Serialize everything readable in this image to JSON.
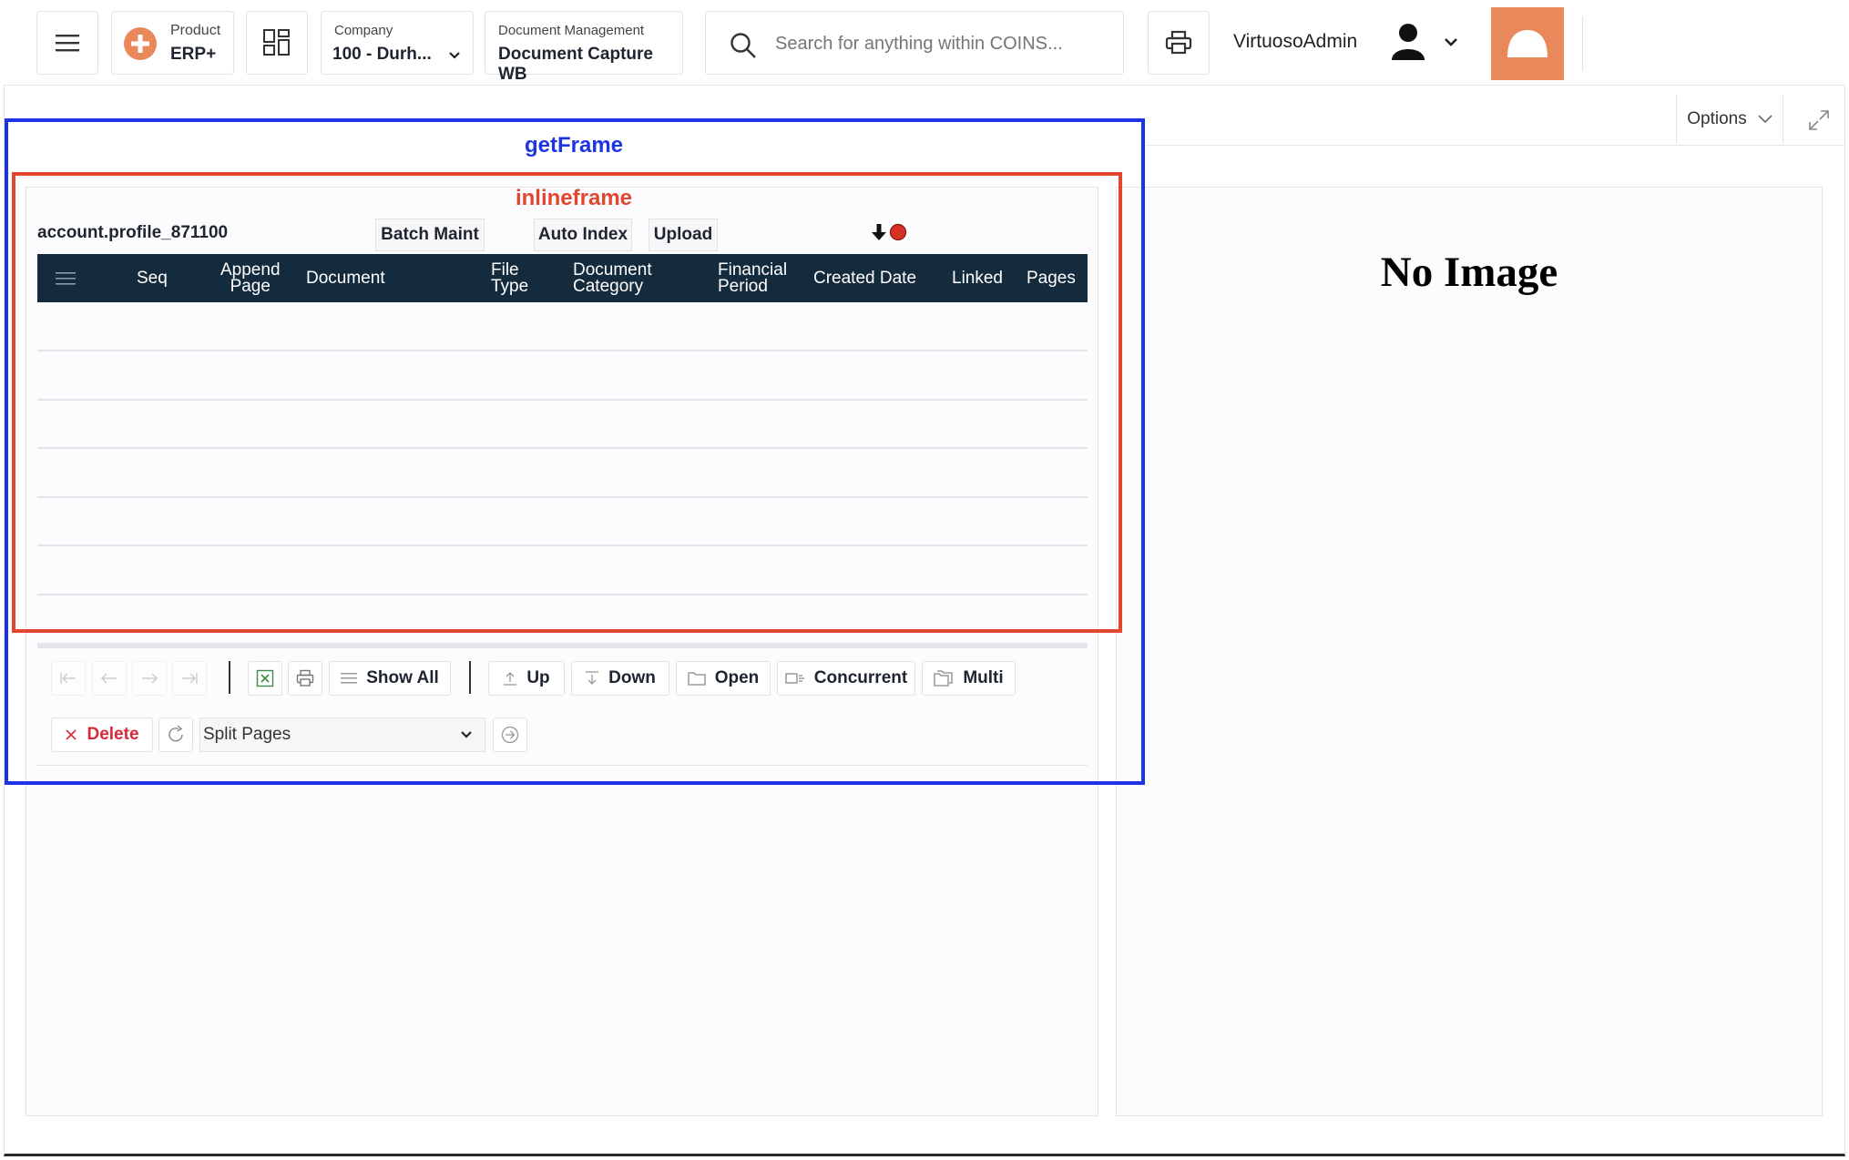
{
  "topbar": {
    "product": {
      "caption": "Product",
      "value": "ERP+"
    },
    "company": {
      "caption": "Company",
      "value": "100 - Durh..."
    },
    "module": {
      "caption": "Document Management",
      "value": "Document Capture WB"
    },
    "search": {
      "placeholder": "Search for anything within COINS..."
    },
    "username": "VirtuosoAdmin",
    "accent_color": "#e8885b"
  },
  "annotations": {
    "outer_label": "getFrame",
    "outer_color": "#1c34e6",
    "inner_label": "inlineframe",
    "inner_color": "#e2462f"
  },
  "grid": {
    "profile": "account.profile_871100",
    "buttons": {
      "batch_maint": "Batch Maint",
      "auto_index": "Auto Index",
      "upload": "Upload"
    },
    "columns": {
      "seq": "Seq",
      "append_page_1": "Append",
      "append_page_2": "Page",
      "document": "Document",
      "file_type_1": "File",
      "file_type_2": "Type",
      "document_category_1": "Document",
      "document_category_2": "Category",
      "financial_period_1": "Financial",
      "financial_period_2": "Period",
      "created_date": "Created Date",
      "linked": "Linked",
      "pages": "Pages"
    },
    "header_color": "#142a3d"
  },
  "toolbar": {
    "show_all": "Show All",
    "up": "Up",
    "down": "Down",
    "open": "Open",
    "concurrent": "Concurrent",
    "multi": "Multi",
    "delete": "Delete",
    "split_pages": "Split Pages"
  },
  "right_panel": {
    "options": "Options",
    "no_image": "No Image"
  }
}
